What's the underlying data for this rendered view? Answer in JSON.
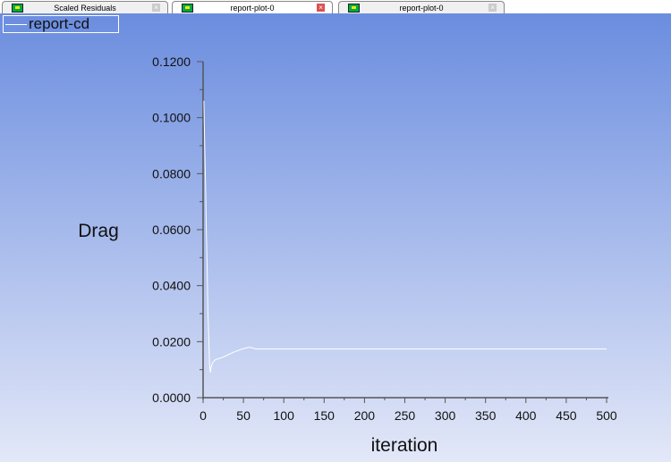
{
  "tabs": [
    {
      "label": "Scaled Residuals",
      "active": false
    },
    {
      "label": "report-plot-0",
      "active": true
    },
    {
      "label": "report-plot-0",
      "active": false
    }
  ],
  "chart_data": {
    "type": "line",
    "title": "",
    "xlabel": "iteration",
    "ylabel": "Drag",
    "xlim": [
      0,
      500
    ],
    "ylim": [
      0,
      0.12
    ],
    "xticks": [
      "0",
      "50",
      "100",
      "150",
      "200",
      "250",
      "300",
      "350",
      "400",
      "450",
      "500"
    ],
    "yticks": [
      "0.0000",
      "0.0200",
      "0.0400",
      "0.0600",
      "0.0800",
      "0.1000",
      "0.1200"
    ],
    "legend": {
      "position": "top-left",
      "entries": [
        "report-cd"
      ]
    },
    "series": [
      {
        "name": "report-cd",
        "color": "#ffffff",
        "x": [
          1,
          2,
          3,
          4,
          5,
          6,
          7,
          8,
          9,
          10,
          12,
          15,
          20,
          25,
          30,
          40,
          50,
          57,
          62,
          65,
          100,
          200,
          300,
          400,
          500
        ],
        "y": [
          0.106,
          0.09,
          0.077,
          0.06,
          0.047,
          0.03,
          0.022,
          0.012,
          0.009,
          0.011,
          0.0125,
          0.0135,
          0.014,
          0.0145,
          0.0152,
          0.0165,
          0.0175,
          0.018,
          0.0177,
          0.0174,
          0.0174,
          0.0174,
          0.0174,
          0.0174,
          0.0174
        ]
      }
    ]
  }
}
